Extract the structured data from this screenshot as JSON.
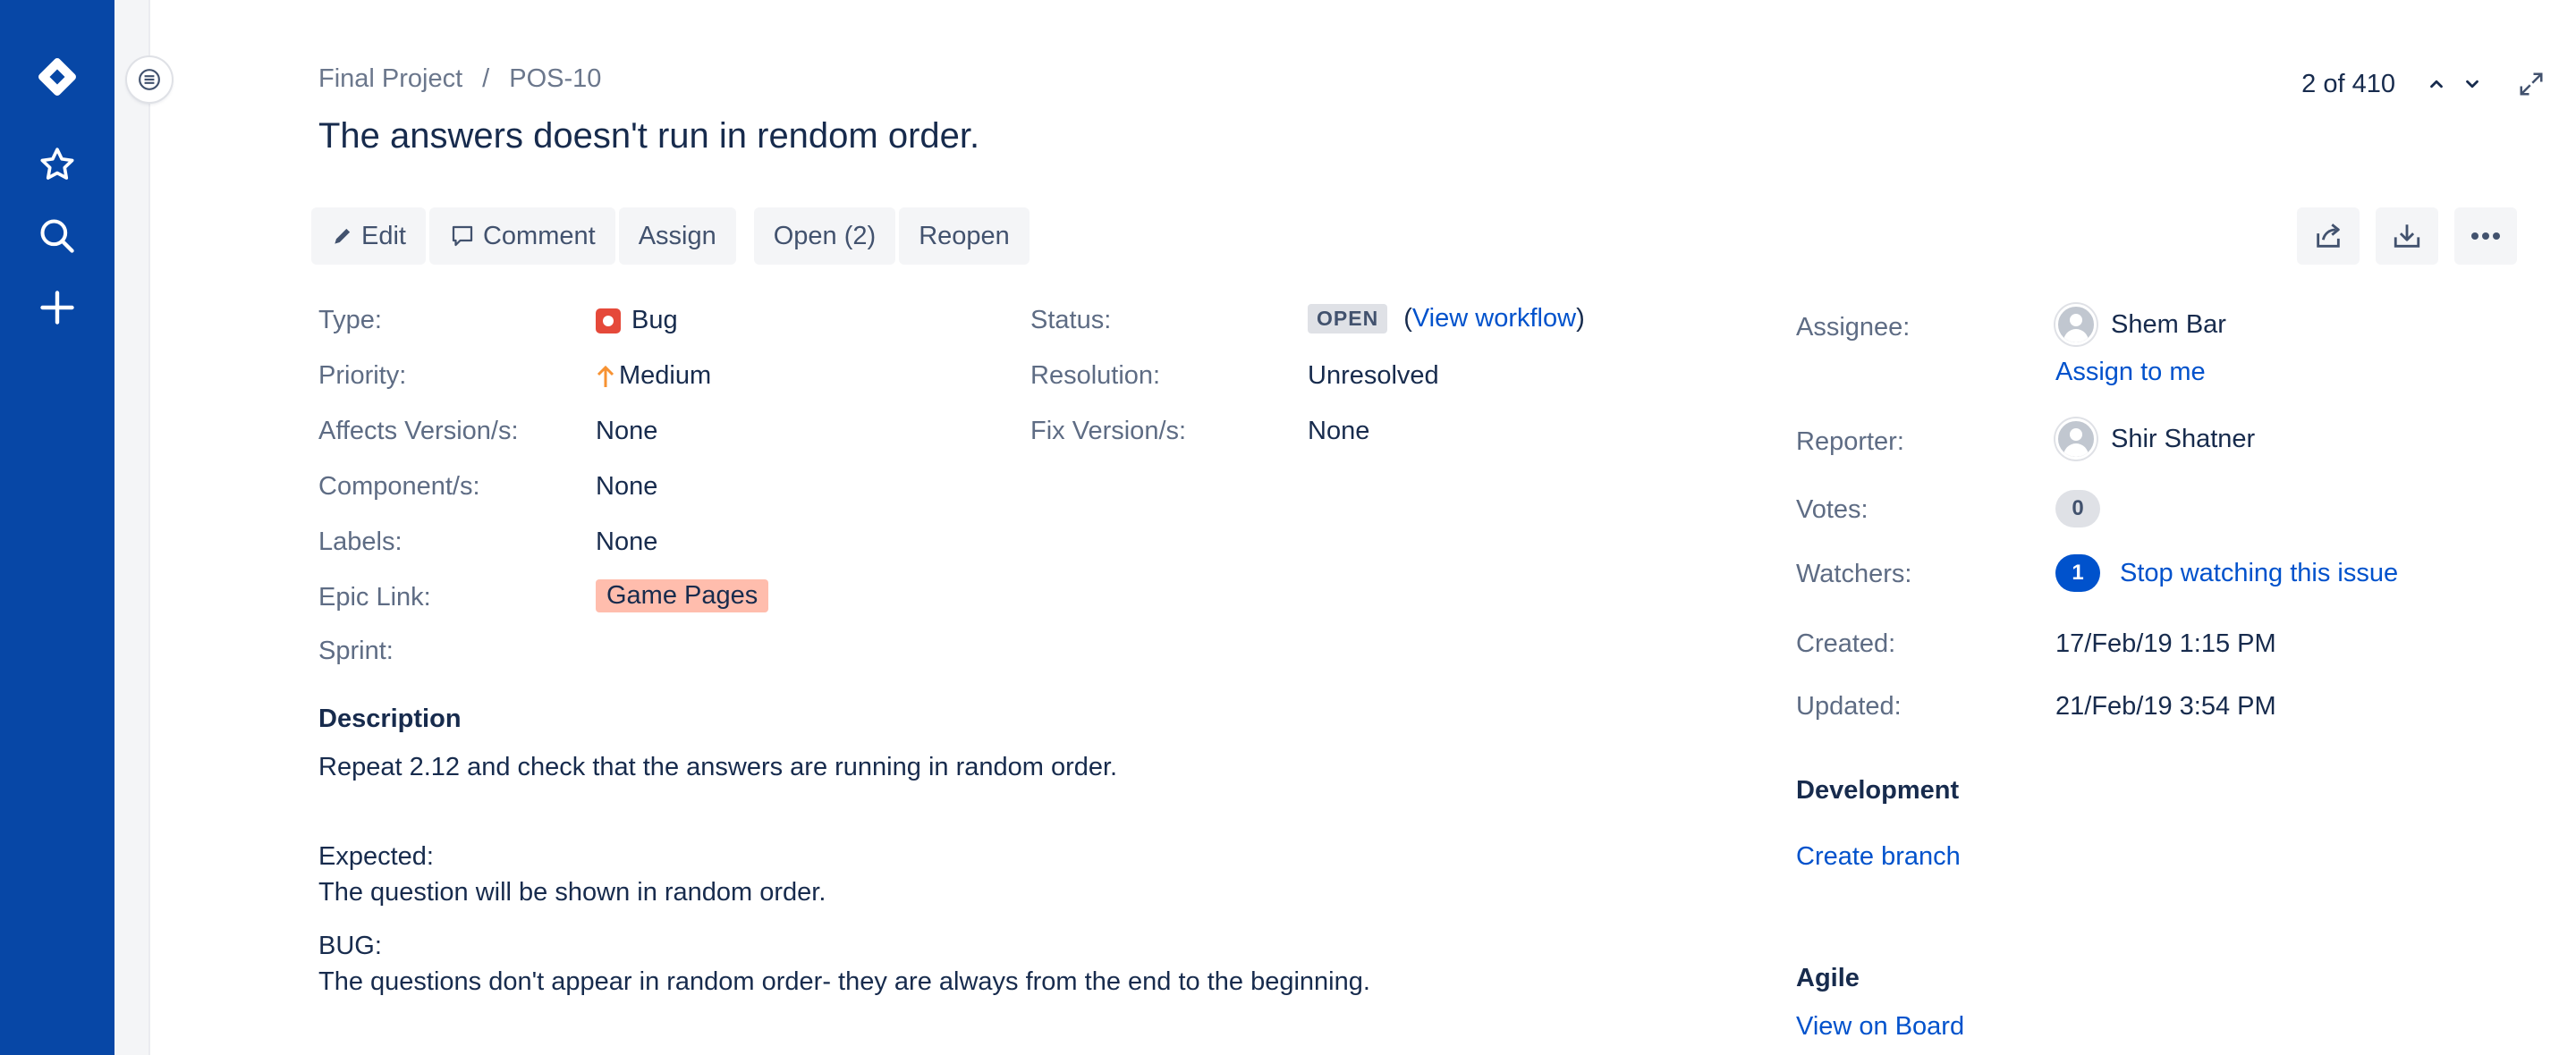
{
  "breadcrumb": {
    "project": "Final Project",
    "separator": "/",
    "issue_key": "POS-10"
  },
  "issue": {
    "title": "The answers doesn't run in rendom order."
  },
  "pager": {
    "count": "2 of 410"
  },
  "toolbar": {
    "edit": "Edit",
    "comment": "Comment",
    "assign": "Assign",
    "open": "Open (2)",
    "reopen": "Reopen"
  },
  "icons": {
    "global_nav": [
      "jira-logo-icon",
      "star-icon",
      "search-icon",
      "plus-icon"
    ],
    "toolbar_right": [
      "share-icon",
      "export-icon",
      "more-icon"
    ]
  },
  "details": {
    "type": {
      "label": "Type:",
      "value": "Bug"
    },
    "priority": {
      "label": "Priority:",
      "value": "Medium"
    },
    "affects": {
      "label": "Affects Version/s:",
      "value": "None"
    },
    "components": {
      "label": "Component/s:",
      "value": "None"
    },
    "labels": {
      "label": "Labels:",
      "value": "None"
    },
    "epic": {
      "label": "Epic Link:",
      "value": "Game Pages"
    },
    "sprint": {
      "label": "Sprint:",
      "value": ""
    },
    "status": {
      "label": "Status:",
      "value": "OPEN",
      "open_paren": "(",
      "workflow_link": "View workflow",
      "close_paren": ")"
    },
    "resolution": {
      "label": "Resolution:",
      "value": "Unresolved"
    },
    "fix": {
      "label": "Fix Version/s:",
      "value": "None"
    }
  },
  "people": {
    "assignee": {
      "label": "Assignee:",
      "name": "Shem Bar",
      "assign_me": "Assign to me"
    },
    "reporter": {
      "label": "Reporter:",
      "name": "Shir Shatner"
    },
    "votes": {
      "label": "Votes:",
      "count": "0"
    },
    "watchers": {
      "label": "Watchers:",
      "count": "1",
      "link": "Stop watching this issue"
    }
  },
  "dates": {
    "created": {
      "label": "Created:",
      "value": "17/Feb/19 1:15 PM"
    },
    "updated": {
      "label": "Updated:",
      "value": "21/Feb/19 3:54 PM"
    }
  },
  "development": {
    "heading": "Development",
    "link": "Create branch"
  },
  "agile": {
    "heading": "Agile",
    "link": "View on Board"
  },
  "description": {
    "heading": "Description",
    "line1": "Repeat 2.12 and check that the answers are running in random order.",
    "line2": "Expected:",
    "line3": "The question will be shown in random order.",
    "line4": "BUG:",
    "line5": "The questions don't appear in random order- they are always from the end to the beginning."
  },
  "colors": {
    "nav": "#0747a6",
    "link": "#0052cc",
    "bug": "#e5493a",
    "priority_medium": "#f79232",
    "epic": "#ffbdad"
  }
}
